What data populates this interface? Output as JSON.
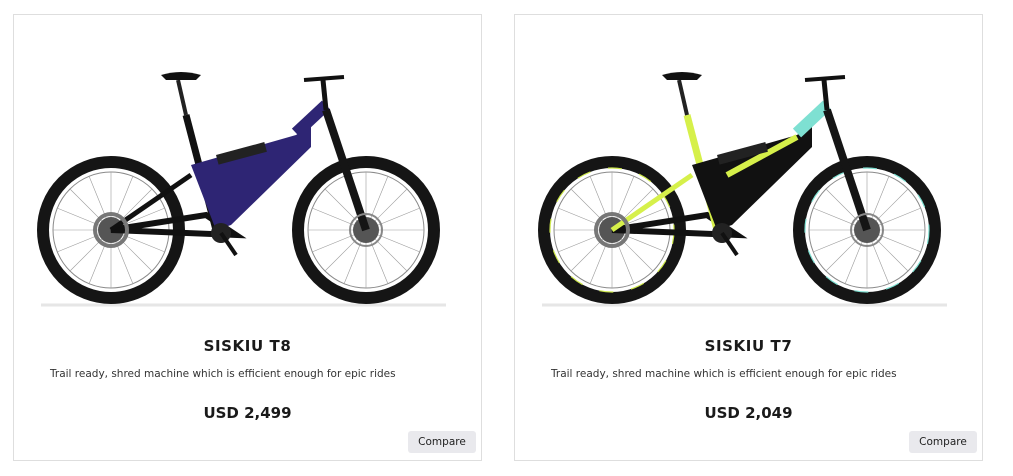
{
  "products": [
    {
      "name": "SISKIU T8",
      "description": "Trail ready, shred machine which is efficient enough for epic rides",
      "price": "USD 2,499",
      "compare_label": "Compare",
      "colors": {
        "frame_front": "#2e2574",
        "frame_rear": "#111111",
        "accent": "#5aa7c8"
      }
    },
    {
      "name": "SISKIU T7",
      "description": "Trail ready, shred machine which is efficient enough for epic rides",
      "price": "USD 2,049",
      "compare_label": "Compare",
      "colors": {
        "frame_front": "#d6f04a",
        "frame_rear": "#111111",
        "accent": "#7ee0d2"
      }
    }
  ]
}
